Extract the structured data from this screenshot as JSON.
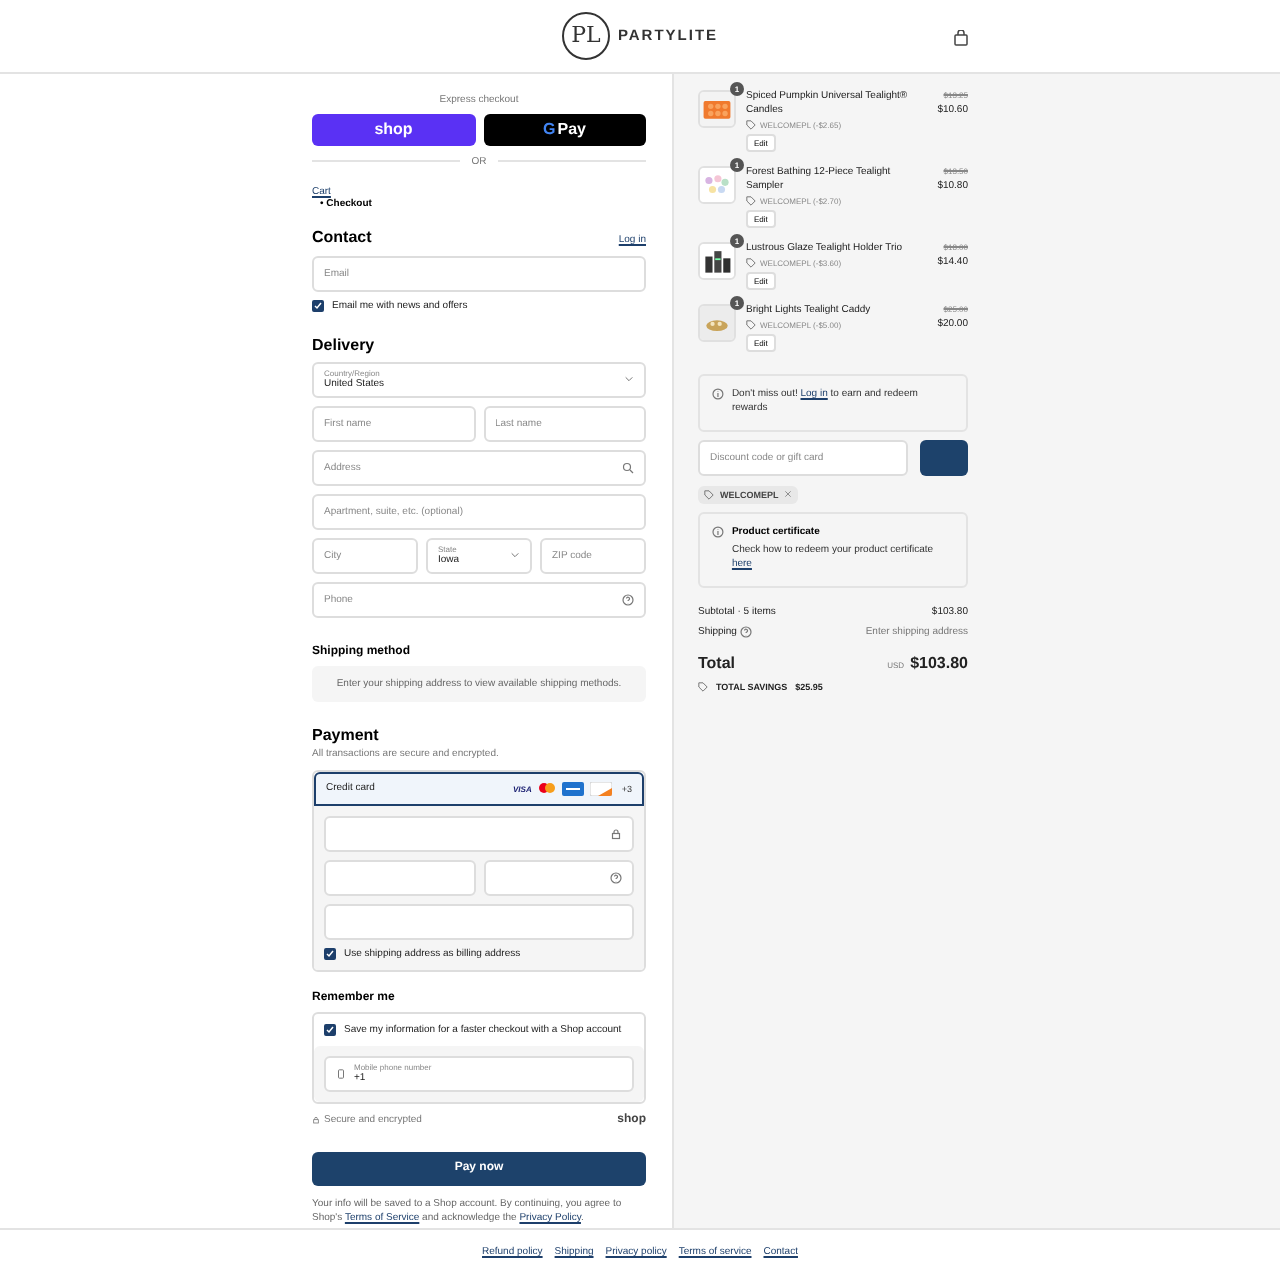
{
  "header": {
    "brand": "PARTYLITE",
    "logo_letters": "PL"
  },
  "express": {
    "title": "Express checkout",
    "buttons": [
      {
        "kind": "shop",
        "label": "shop"
      },
      {
        "kind": "gpay",
        "mark": "G",
        "label": "Pay"
      }
    ],
    "divider": "OR"
  },
  "breadcrumbs": [
    {
      "label": "Cart",
      "current": false
    },
    {
      "label": "Checkout",
      "current": true,
      "marker": "•"
    }
  ],
  "contact": {
    "heading": "Contact",
    "login": "Log in",
    "email": {
      "placeholder": "Email"
    },
    "newsletter": {
      "label": "Email me with news and offers",
      "checked": true
    }
  },
  "delivery": {
    "heading": "Delivery",
    "rows": [
      [
        {
          "kind": "select",
          "label": "Country/Region",
          "value": "United States"
        }
      ],
      [
        {
          "kind": "text",
          "placeholder": "First name"
        },
        {
          "kind": "text",
          "placeholder": "Last name"
        }
      ],
      [
        {
          "kind": "search",
          "placeholder": "Address"
        }
      ],
      [
        {
          "kind": "text",
          "placeholder": "Apartment, suite, etc. (optional)"
        }
      ],
      [
        {
          "kind": "text",
          "placeholder": "City"
        },
        {
          "kind": "select",
          "label": "State",
          "value": "Iowa"
        },
        {
          "kind": "text",
          "placeholder": "ZIP code"
        }
      ],
      [
        {
          "kind": "help",
          "placeholder": "Phone"
        }
      ]
    ]
  },
  "shipping_method": {
    "heading": "Shipping method",
    "notice": "Enter your shipping address to view available shipping methods."
  },
  "payment": {
    "heading": "Payment",
    "subtitle": "All transactions are secure and encrypted.",
    "method": {
      "label": "Credit card",
      "selected": true,
      "cards": [
        {
          "kind": "visa",
          "label": "VISA"
        },
        {
          "kind": "mastercard"
        },
        {
          "kind": "amex"
        },
        {
          "kind": "discover"
        }
      ],
      "more": "+3"
    },
    "card_rows": [
      [
        {
          "kind": "lock"
        }
      ],
      [
        {
          "kind": "text"
        },
        {
          "kind": "help"
        }
      ],
      [
        {
          "kind": "text"
        }
      ]
    ],
    "billing": {
      "label": "Use shipping address as billing address",
      "checked": true
    }
  },
  "remember": {
    "heading": "Remember me",
    "save": {
      "label": "Save my information for a faster checkout with a Shop account",
      "checked": true
    },
    "phone": {
      "label": "Mobile phone number",
      "value": "+1"
    },
    "secure": "Secure and encrypted",
    "brand": "shop"
  },
  "pay_button": "Pay now",
  "disclaimer": [
    {
      "text": "Your info will be saved to a Shop account. By continuing, you agree to Shop's "
    },
    {
      "link": "Terms of Service"
    },
    {
      "text": " and acknowledge the "
    },
    {
      "link": "Privacy Policy"
    },
    {
      "text": "."
    }
  ],
  "footer": [
    "Refund policy",
    "Shipping",
    "Privacy policy",
    "Terms of service",
    "Contact"
  ],
  "summary": {
    "items": [
      {
        "name": "Spiced Pumpkin Universal Tealight® Candles",
        "quantity": "1",
        "discount": "WELCOMEPL (-$2.65)",
        "original": "$13.25",
        "price": "$10.60",
        "edit": "Edit",
        "kind": "picture"
      },
      {
        "name": "Forest Bathing 12-Piece Tealight Sampler",
        "quantity": "1",
        "discount": "WELCOMEPL (-$2.70)",
        "original": "$13.50",
        "price": "$10.80",
        "edit": "Edit",
        "kind": "picture"
      },
      {
        "name": "Lustrous Glaze Tealight Holder Trio",
        "quantity": "1",
        "discount": "WELCOMEPL (-$3.60)",
        "original": "$18.00",
        "price": "$14.40",
        "edit": "Edit",
        "kind": "picture"
      },
      {
        "name": "Bright Lights Tealight Caddy",
        "quantity": "1",
        "discount": "WELCOMEPL (-$5.00)",
        "original": "$25.00",
        "price": "$20.00",
        "edit": "Edit",
        "kind": "picture"
      }
    ],
    "notice": [
      {
        "text": "Don't miss out! "
      },
      {
        "link": "Log in"
      },
      {
        "text": " to earn and redeem rewards"
      }
    ],
    "discount_field": {
      "placeholder": "Discount code or gift card"
    },
    "applied_code": "WELCOMEPL",
    "certificate": {
      "title": "Product certificate",
      "text": "Check how to redeem your product certificate ",
      "link": "here"
    },
    "subtotal": {
      "label": "Subtotal · 5 items",
      "value": "$103.80"
    },
    "shipping": {
      "label": "Shipping",
      "value": "Enter shipping address"
    },
    "total": {
      "label": "Total",
      "currency": "USD",
      "value": "$103.80"
    },
    "savings": {
      "label": "TOTAL SAVINGS",
      "value": "$25.95"
    }
  }
}
